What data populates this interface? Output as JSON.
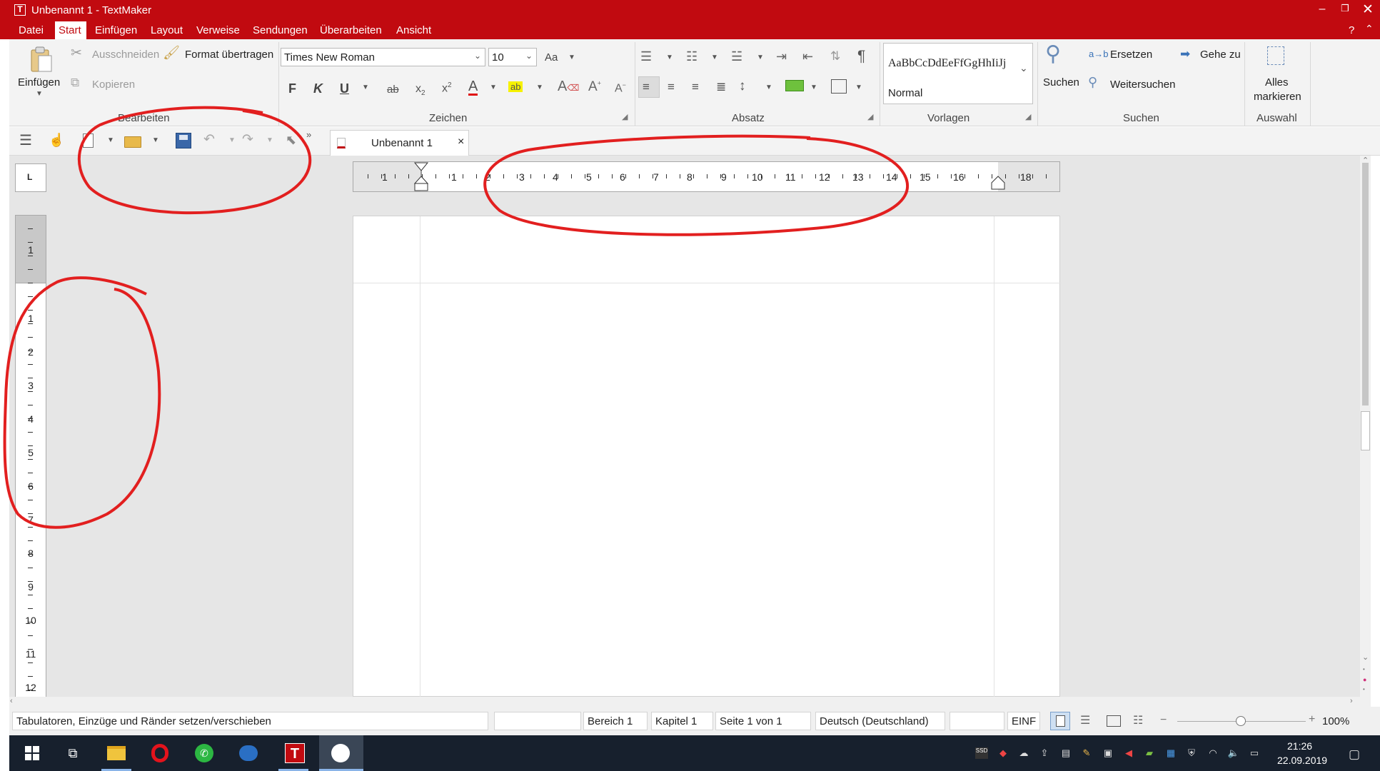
{
  "window": {
    "title": "Unbenannt 1 - TextMaker",
    "help_label": "?"
  },
  "menu": [
    "Datei",
    "Start",
    "Einfügen",
    "Layout",
    "Verweise",
    "Sendungen",
    "Überarbeiten",
    "Ansicht"
  ],
  "ribbon": {
    "paste_label": "Einfügen",
    "cut_label": "Ausschneiden",
    "copy_label": "Kopieren",
    "format_painter_label": "Format übertragen",
    "group_edit": "Bearbeiten",
    "font_name": "Times New Roman",
    "font_size": "10",
    "group_font": "Zeichen",
    "bold": "F",
    "italic": "K",
    "underline": "U",
    "group_paragraph": "Absatz",
    "style_preview": "AaBbCcDdEeFfGgHhIiJj",
    "style_name": "Normal",
    "group_styles": "Vorlagen",
    "search_label": "Suchen",
    "replace_label": "Ersetzen",
    "find_next_label": "Weitersuchen",
    "goto_label": "Gehe zu",
    "group_search": "Suchen",
    "select_all_line1": "Alles",
    "select_all_line2": "markieren",
    "group_selection": "Auswahl"
  },
  "document_tab": {
    "label": "Unbenannt 1",
    "close": "×"
  },
  "ruler_corner": "L",
  "hruler_labels": [
    "1",
    "1",
    "2",
    "3",
    "4",
    "5",
    "6",
    "7",
    "8",
    "9",
    "10",
    "11",
    "12",
    "13",
    "14",
    "15",
    "16",
    "18"
  ],
  "vruler_labels": [
    "1",
    "1",
    "2",
    "3",
    "4",
    "5",
    "6",
    "7",
    "8",
    "9",
    "10",
    "11",
    "12"
  ],
  "status": {
    "hint": "Tabulatoren, Einzüge und Ränder setzen/verschieben",
    "section": "Bereich 1",
    "chapter": "Kapitel 1",
    "page": "Seite 1 von 1",
    "language": "Deutsch (Deutschland)",
    "mode": "EINF",
    "zoom": "100%"
  },
  "taskbar": {
    "time": "21:26",
    "date": "22.09.2019"
  }
}
